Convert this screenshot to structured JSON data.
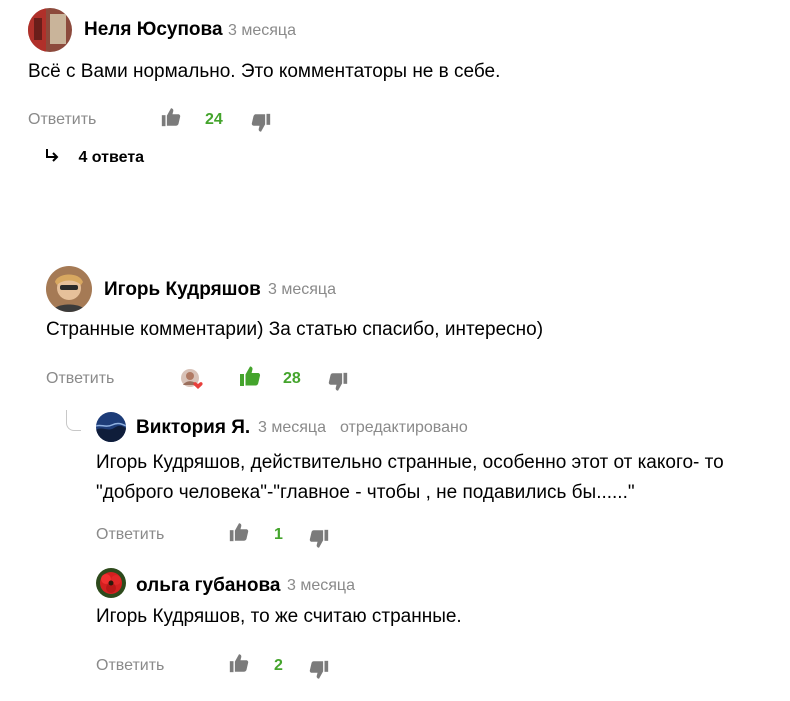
{
  "comments": [
    {
      "author": "Неля Юсупова",
      "time": "3 месяца",
      "text": "Всё с Вами нормально. Это комментаторы не в себе.",
      "reply_label": "Ответить",
      "likes": "24",
      "replies_toggle": "4 ответа"
    },
    {
      "author": "Игорь Кудряшов",
      "time": "3 месяца",
      "text": "Странные комментарии) За статью спасибо, интересно)",
      "reply_label": "Ответить",
      "likes": "28",
      "liked": true
    },
    {
      "author": "Виктория Я.",
      "time": "3 месяца",
      "edited": "отредактировано",
      "text_line1": "Игорь Кудряшов, действительно странные, особенно этот от какого- то",
      "text_line2": "\"доброго человека\"-\"главное - чтобы , не подавились бы......\"",
      "reply_label": "Ответить",
      "likes": "1"
    },
    {
      "author": "ольга губанова",
      "time": "3 месяца",
      "text": "Игорь Кудряшов, то же считаю странные.",
      "reply_label": "Ответить",
      "likes": "2"
    }
  ],
  "colors": {
    "like_active": "#44a42c",
    "icon_gray": "#7b7b7b",
    "meta_gray": "#8a8a8a"
  }
}
